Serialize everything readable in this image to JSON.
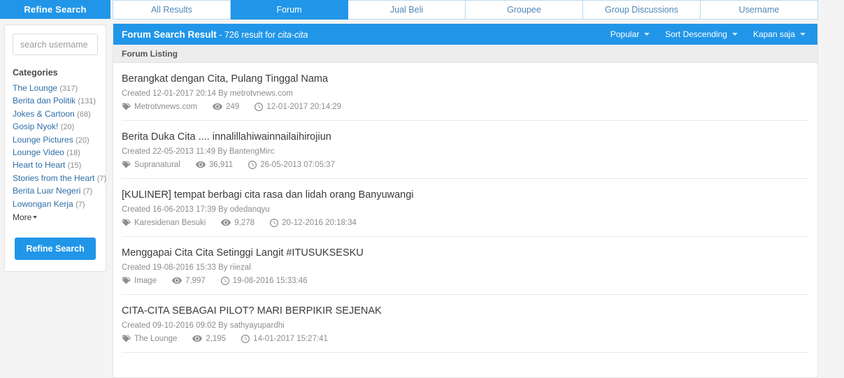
{
  "sidebar": {
    "header_label": "Refine Search",
    "search_placeholder": "search username",
    "search_value": "",
    "categories_title": "Categories",
    "categories": [
      {
        "label": "The Lounge",
        "count": "(317)"
      },
      {
        "label": "Berita dan Politik",
        "count": "(131)"
      },
      {
        "label": "Jokes & Cartoon",
        "count": "(68)"
      },
      {
        "label": "Gosip Nyok!",
        "count": "(20)"
      },
      {
        "label": "Lounge Pictures",
        "count": "(20)"
      },
      {
        "label": "Lounge Video",
        "count": "(18)"
      },
      {
        "label": "Heart to Heart",
        "count": "(15)"
      },
      {
        "label": "Stories from the Heart",
        "count": "(7)"
      },
      {
        "label": "Berita Luar Negeri",
        "count": "(7)"
      },
      {
        "label": "Lowongan Kerja",
        "count": "(7)"
      }
    ],
    "more_label": "More",
    "refine_button": "Refine Search"
  },
  "tabs": [
    {
      "label": "All Results",
      "active": false
    },
    {
      "label": "Forum",
      "active": true
    },
    {
      "label": "Jual Beli",
      "active": false
    },
    {
      "label": "Groupee",
      "active": false
    },
    {
      "label": "Group Discussions",
      "active": false
    },
    {
      "label": "Username",
      "active": false
    }
  ],
  "result_header": {
    "title": "Forum Search Result",
    "summary": " - 726 result for ",
    "term": "cita-cita",
    "dropdowns": [
      {
        "label": "Popular"
      },
      {
        "label": "Sort Descending"
      },
      {
        "label": "Kapan saja"
      }
    ]
  },
  "listing_bar": {
    "label": "Forum Listing"
  },
  "results": [
    {
      "title": "Berangkat dengan Cita, Pulang Tinggal Nama",
      "created": "Created 12-01-2017 20:14 By metrotvnews.com",
      "tag": "Metrotvnews.com",
      "views": "249",
      "timestamp": "12-01-2017 20:14:29"
    },
    {
      "title": "Berita Duka Cita .... innalillahiwainnailaihirojiun",
      "created": "Created 22-05-2013 11:49 By BantengMirc",
      "tag": "Supranatural",
      "views": "36,911",
      "timestamp": "26-05-2013 07:05:37"
    },
    {
      "title": "[KULINER] tempat berbagi cita rasa dan lidah orang Banyuwangi",
      "created": "Created 16-06-2013 17:39 By odedanqyu",
      "tag": "Karesidenan Besuki",
      "views": "9,278",
      "timestamp": "20-12-2016 20:18:34"
    },
    {
      "title": "Menggapai Cita Cita Setinggi Langit #ITUSUKSESKU",
      "created": "Created 19-08-2016 15:33 By riiezal",
      "tag": "Image",
      "views": "7,997",
      "timestamp": "19-08-2016 15:33:46"
    },
    {
      "title": "CITA-CITA SEBAGAI PILOT? MARI BERPIKIR SEJENAK",
      "created": "Created 09-10-2016 09:02 By sathyayupardhi",
      "tag": "The Lounge",
      "views": "2,195",
      "timestamp": "14-01-2017 15:27:41"
    }
  ],
  "colors": {
    "accent_blue": "#2196e8",
    "tab_text": "#4f87b8",
    "link_blue": "#2c6fa8",
    "meta_gray": "#8d8d8d"
  }
}
